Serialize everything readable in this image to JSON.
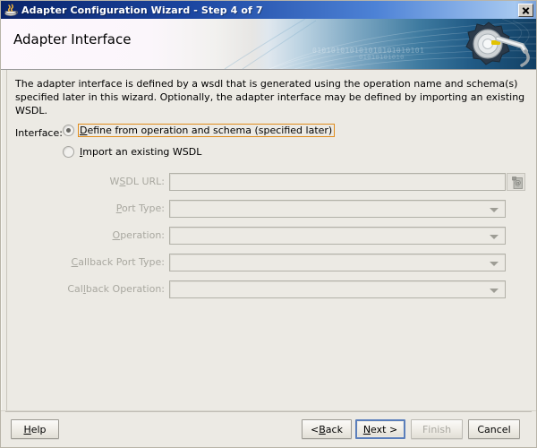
{
  "window": {
    "title": "Adapter Configuration Wizard - Step 4 of 7",
    "icon": "java-coffee-cup-icon",
    "close_label": "×"
  },
  "banner": {
    "heading": "Adapter Interface",
    "binary_line_1": "010101010101010101010101",
    "binary_line_2": "01010101010",
    "gear_icon": "gear-wrench-icon"
  },
  "content": {
    "intro": "The adapter interface is defined by a wsdl that is generated using the operation name and schema(s) specified later in this wizard.  Optionally, the adapter interface may be defined by importing an existing WSDL.",
    "interface_label": "Interface:",
    "options": [
      {
        "prefix": "",
        "mnemonic": "D",
        "rest": "efine from operation and schema (specified later)",
        "selected": true,
        "focused": true
      },
      {
        "prefix": "",
        "mnemonic": "I",
        "rest": "mport an existing WSDL",
        "selected": false,
        "focused": false
      }
    ],
    "fields": [
      {
        "prefix": "W",
        "mnemonic": "S",
        "rest": "DL URL:",
        "type": "text",
        "value": "",
        "disabled": true
      },
      {
        "prefix": "",
        "mnemonic": "P",
        "rest": "ort Type:",
        "type": "combo",
        "value": "",
        "disabled": true
      },
      {
        "prefix": "",
        "mnemonic": "O",
        "rest": "peration:",
        "type": "combo",
        "value": "",
        "disabled": true
      },
      {
        "prefix": "",
        "mnemonic": "C",
        "rest": "allback Port Type:",
        "type": "combo",
        "value": "",
        "disabled": true
      },
      {
        "prefix": "Cal",
        "mnemonic": "l",
        "rest": "back Operation:",
        "type": "combo",
        "value": "",
        "disabled": true
      }
    ],
    "browse_button": {
      "icon": "browse-wsdl-document-icon",
      "disabled": true
    }
  },
  "buttons": {
    "help": {
      "prefix": "",
      "mnemonic": "H",
      "rest": "elp",
      "disabled": false,
      "default": false
    },
    "back": {
      "prefix": "< ",
      "mnemonic": "B",
      "rest": "ack",
      "disabled": false,
      "default": false
    },
    "next": {
      "prefix": "",
      "mnemonic": "N",
      "rest": "ext >",
      "disabled": false,
      "default": true
    },
    "finish": {
      "prefix": "",
      "mnemonic": "F",
      "rest": "inish",
      "disabled": true,
      "default": false
    },
    "cancel": {
      "prefix": "",
      "mnemonic": "C",
      "rest": "ancel",
      "disabled": false,
      "default": false
    }
  },
  "colors": {
    "titlebar_start": "#0a246a",
    "titlebar_end": "#a6c8f0",
    "focus_orange": "#e08c1c",
    "default_button_blue": "#5b7fbb",
    "panel_bg": "#eceae4"
  }
}
